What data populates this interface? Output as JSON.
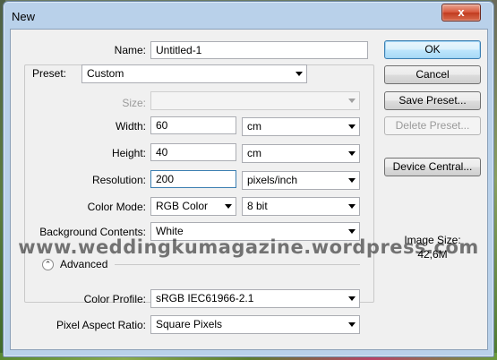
{
  "window": {
    "title": "New",
    "close_glyph": "x"
  },
  "fields": {
    "name": {
      "label": "Name:",
      "value": "Untitled-1"
    },
    "preset": {
      "label": "Preset:",
      "value": "Custom"
    },
    "size": {
      "label": "Size:",
      "value": ""
    },
    "width": {
      "label": "Width:",
      "value": "60",
      "unit": "cm"
    },
    "height": {
      "label": "Height:",
      "value": "40",
      "unit": "cm"
    },
    "resolution": {
      "label": "Resolution:",
      "value": "200",
      "unit": "pixels/inch"
    },
    "color_mode": {
      "label": "Color Mode:",
      "value": "RGB Color",
      "depth": "8 bit"
    },
    "background": {
      "label": "Background Contents:",
      "value": "White"
    },
    "advanced": {
      "label": "Advanced",
      "toggle_glyph": "⌃"
    },
    "color_profile": {
      "label": "Color Profile:",
      "value": "sRGB IEC61966-2.1"
    },
    "pixel_aspect": {
      "label": "Pixel Aspect Ratio:",
      "value": "Square Pixels"
    }
  },
  "buttons": {
    "ok": "OK",
    "cancel": "Cancel",
    "save_preset": "Save Preset...",
    "delete_preset": "Delete Preset...",
    "device_central": "Device Central..."
  },
  "image_size": {
    "label": "Image Size:",
    "value": "42,6M"
  },
  "watermark": "www.weddingkumagazine.wordpress.com"
}
